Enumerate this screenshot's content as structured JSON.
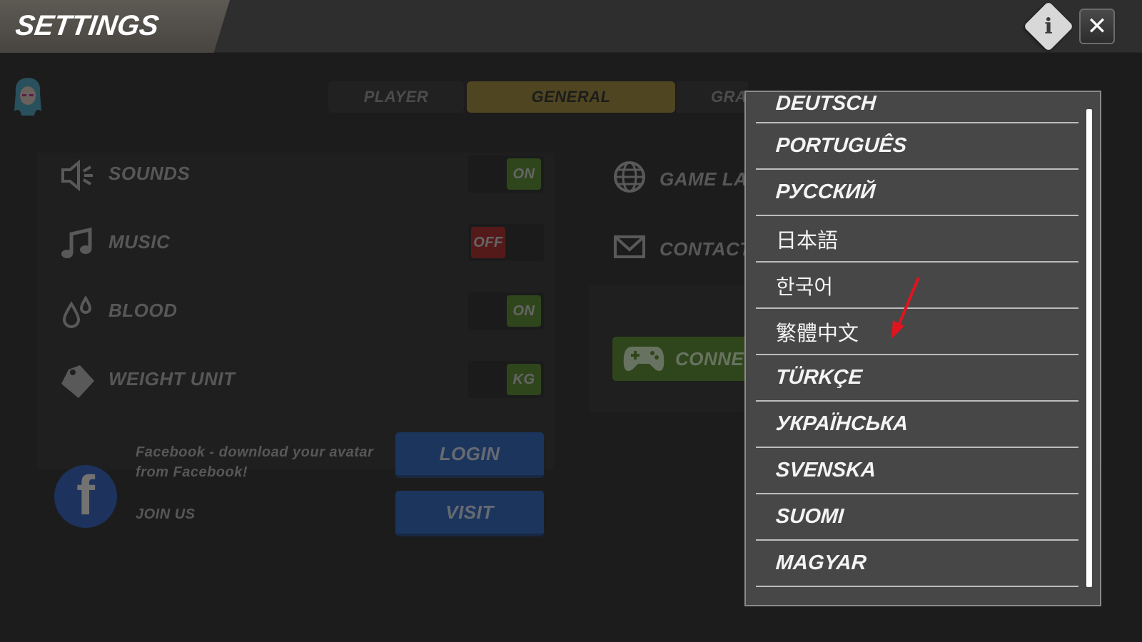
{
  "header": {
    "title": "SETTINGS",
    "info_icon": "i",
    "close_icon": "✕"
  },
  "tabs": [
    {
      "label": "PLAYER",
      "active": false
    },
    {
      "label": "GENERAL",
      "active": true
    },
    {
      "label": "GRAP",
      "active": false
    }
  ],
  "settings_left": [
    {
      "label": "SOUNDS",
      "icon": "speaker-icon",
      "value": "ON",
      "state": "on"
    },
    {
      "label": "MUSIC",
      "icon": "music-note-icon",
      "value": "OFF",
      "state": "off"
    },
    {
      "label": "BLOOD",
      "icon": "blood-drops-icon",
      "value": "ON",
      "state": "on"
    },
    {
      "label": "WEIGHT UNIT",
      "icon": "weight-icon",
      "value": "KG",
      "state": "on"
    }
  ],
  "settings_right": [
    {
      "label": "GAME LANG",
      "icon": "globe-icon"
    },
    {
      "label": "CONTACT U",
      "icon": "envelope-icon"
    }
  ],
  "connect": {
    "label": "CONNECT",
    "icon": "gamepad-icon"
  },
  "facebook": {
    "description": "Facebook - download your avatar from Facebook!",
    "join_label": "JOIN US",
    "login_label": "LOGIN",
    "visit_label": "VISIT"
  },
  "language_dropdown": {
    "items": [
      "DEUTSCH",
      "PORTUGUÊS",
      "РУССКИЙ",
      "日本語",
      "한국어",
      "繁體中文",
      "TÜRKÇE",
      "УКРАЇНСЬКА",
      "SVENSKA",
      "SUOMI",
      "MAGYAR"
    ]
  },
  "colors": {
    "accent_general_tab": "#a38a2a",
    "toggle_on": "#4f8a1e",
    "toggle_off": "#b01818",
    "facebook_blue": "#1e5fc7",
    "annotation_arrow": "#e0141e"
  }
}
